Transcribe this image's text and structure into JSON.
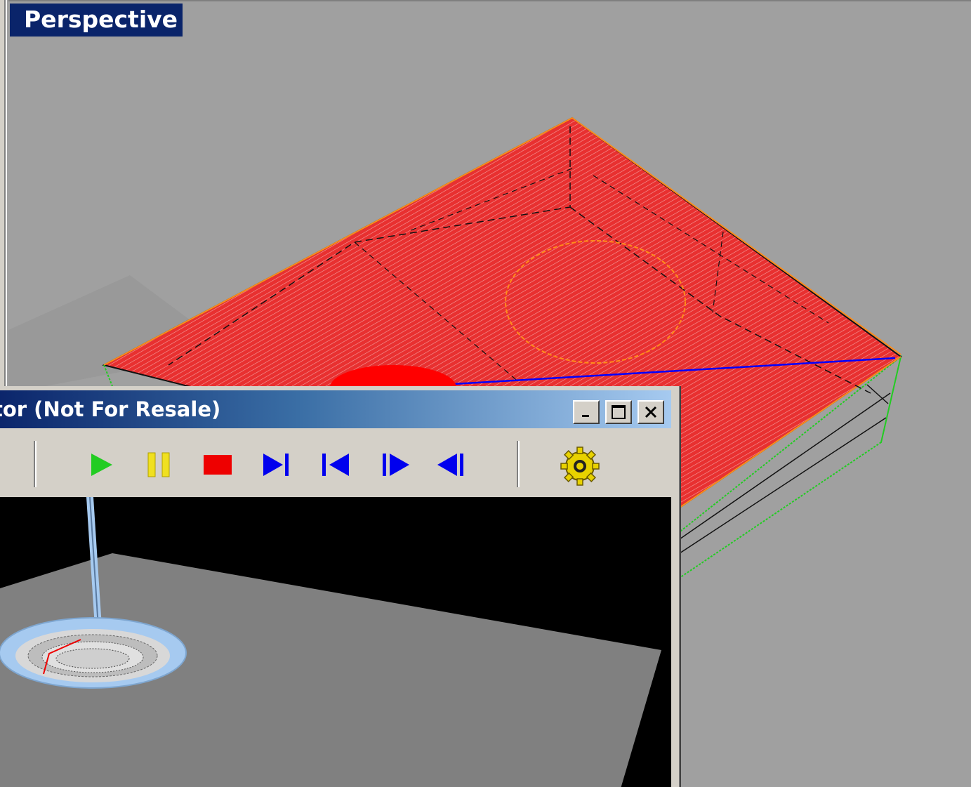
{
  "viewport": {
    "label": "Perspective"
  },
  "simulator": {
    "title": "tor (Not For Resale)",
    "title_buttons": [
      "minimize",
      "maximize",
      "close"
    ],
    "toolbar": [
      {
        "name": "play",
        "icon": "play-icon",
        "color": "#22cc22"
      },
      {
        "name": "pause",
        "icon": "pause-icon",
        "color": "#f0e020"
      },
      {
        "name": "stop",
        "icon": "stop-icon",
        "color": "#ee0000"
      },
      {
        "name": "step-forward-end",
        "icon": "skip-to-end-icon",
        "color": "#0000ee"
      },
      {
        "name": "step-back-start",
        "icon": "skip-to-start-icon",
        "color": "#0000ee"
      },
      {
        "name": "step-forward",
        "icon": "step-forward-icon",
        "color": "#0000ee"
      },
      {
        "name": "step-back",
        "icon": "step-back-icon",
        "color": "#0000ee"
      },
      {
        "name": "settings",
        "icon": "gear-icon",
        "color": "#e8d200"
      }
    ]
  },
  "colors": {
    "viewport_bg": "#a0a0a0",
    "label_bg": "#0a246a",
    "part_fill": "#e83030",
    "edge_orange": "#ff8c1a",
    "edge_green": "#22cc22",
    "toolpath_blue": "#0000ff",
    "sim_bg": "#000000",
    "sim_floor": "#808080",
    "tool_blue": "#a6caf0"
  }
}
